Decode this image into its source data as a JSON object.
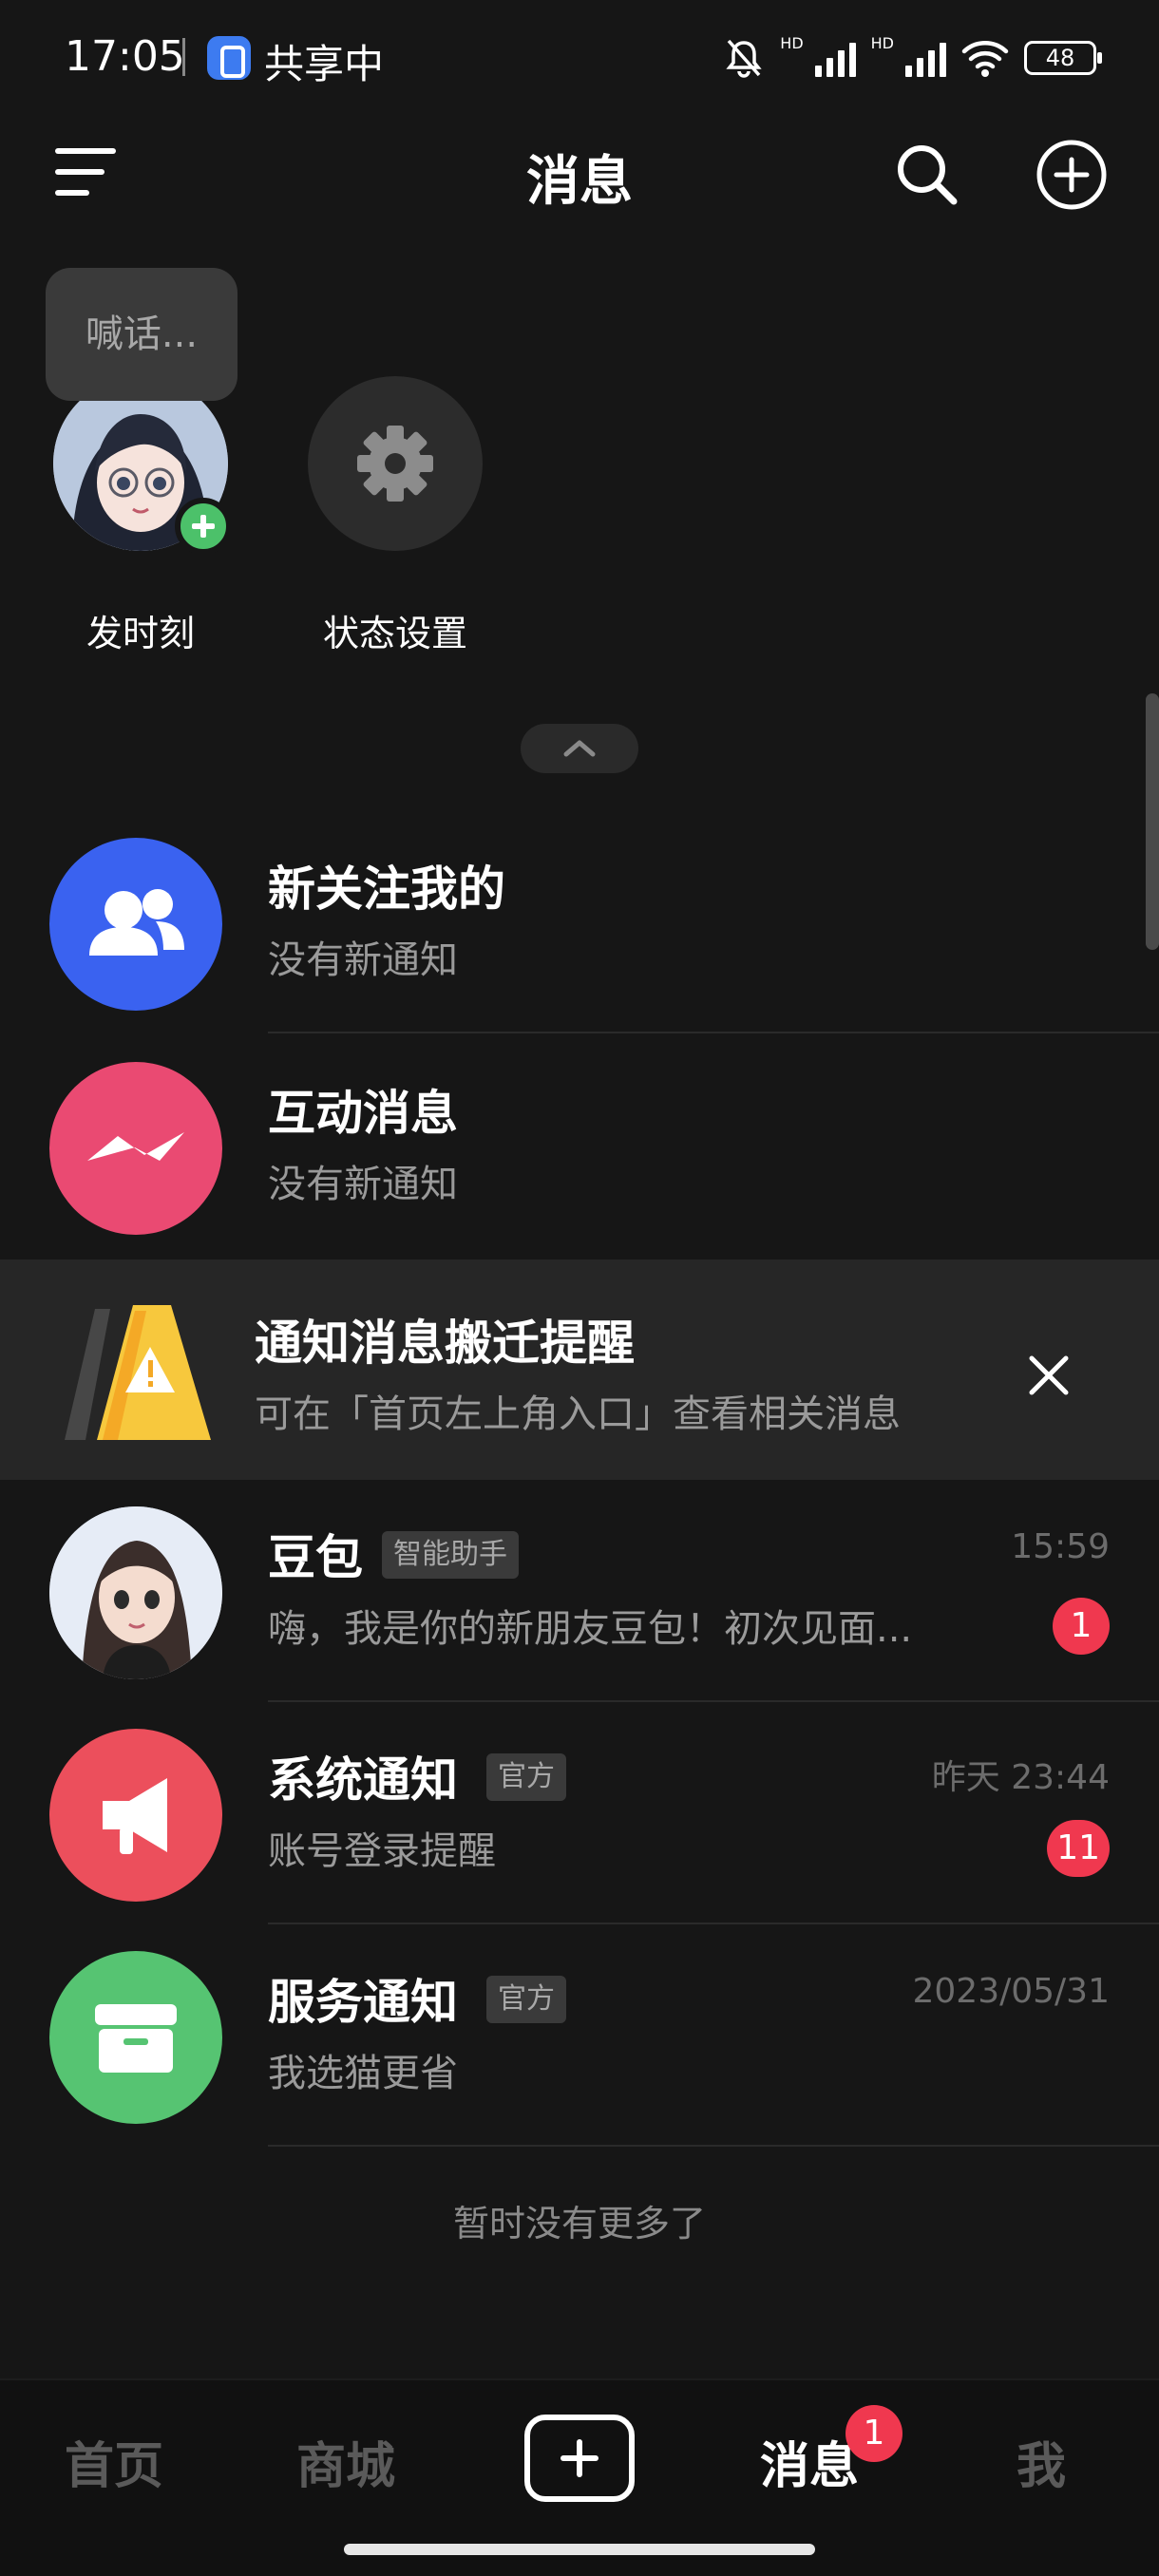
{
  "status_bar": {
    "time": "17:05",
    "sharing_label": "共享中",
    "battery": "48",
    "icons": [
      "screen-share-icon",
      "mute-bell-icon",
      "signal-hd-icon",
      "signal-hd-icon",
      "wifi-icon",
      "battery-icon"
    ]
  },
  "header": {
    "title": "消息",
    "icons": [
      "menu-icon",
      "search-icon",
      "add-circle-icon"
    ]
  },
  "stories": {
    "bubble_text": "喊话...",
    "items": [
      {
        "label": "发时刻",
        "icon": "avatar-with-plus"
      },
      {
        "label": "状态设置",
        "icon": "gear-icon"
      }
    ]
  },
  "rows": {
    "followers": {
      "title": "新关注我的",
      "subtitle": "没有新通知",
      "icon": "people-icon"
    },
    "interactions": {
      "title": "互动消息",
      "subtitle": "没有新通知",
      "icon": "wave-icon"
    }
  },
  "notice": {
    "title": "通知消息搬迁提醒",
    "subtitle": "可在「首页左上角入口」查看相关消息",
    "icon": "warning-sign-icon"
  },
  "conversations": [
    {
      "name": "豆包",
      "tag": "智能助手",
      "preview": "嗨，我是你的新朋友豆包！初次见面...",
      "time": "15:59",
      "unread": "1"
    },
    {
      "name": "系统通知",
      "tag": "官方",
      "preview": "账号登录提醒",
      "time": "昨天 23:44",
      "unread": "11"
    },
    {
      "name": "服务通知",
      "tag": "官方",
      "preview": "我选猫更省",
      "time": "2023/05/31",
      "unread": ""
    }
  ],
  "end_text": "暂时没有更多了",
  "bottom_nav": {
    "items": [
      "首页",
      "商城",
      "消息",
      "我"
    ],
    "active": "消息",
    "message_badge": "1"
  },
  "colors": {
    "background": "#161616",
    "badge": "#f0384f",
    "follow_blue": "#3a62f0",
    "interact_pink": "#ea4a72",
    "system_red": "#ec4f5c",
    "service_green": "#56c472",
    "plus_green": "#4cc16a"
  }
}
